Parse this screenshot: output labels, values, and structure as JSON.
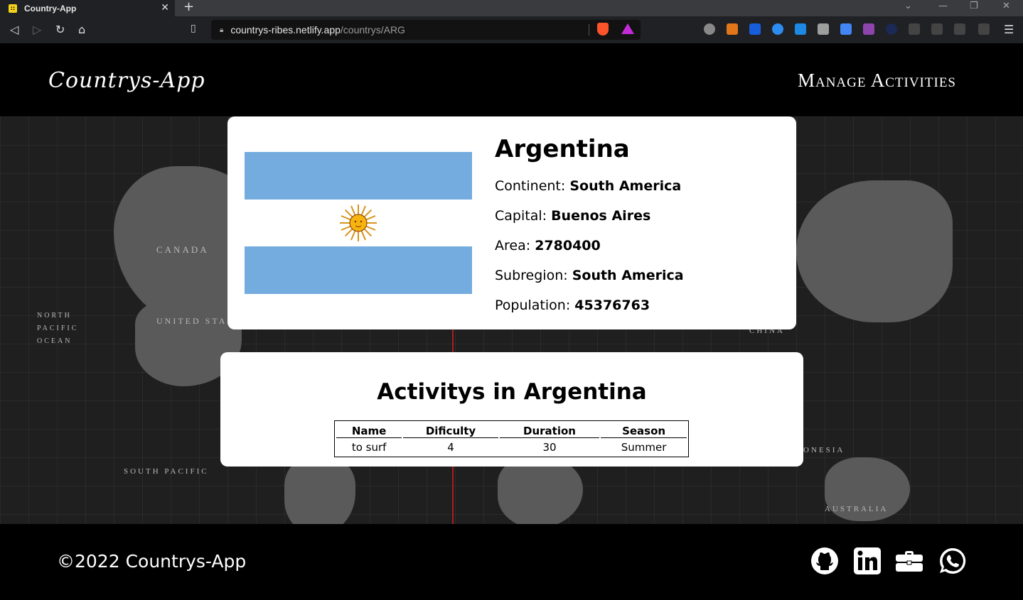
{
  "browser": {
    "tab_title": "Country-App",
    "tab_favicon": "::",
    "new_tab_label": "+",
    "close_label": "✕",
    "url_host": "countrys-ribes.netlify.app",
    "url_path": "/countrys/ARG"
  },
  "header": {
    "brand": "Countrys-App",
    "manage_link": "Manage Activities"
  },
  "country": {
    "name": "Argentina",
    "fields": [
      {
        "label": "Continent:",
        "value": "South America"
      },
      {
        "label": "Capital:",
        "value": "Buenos Aires"
      },
      {
        "label": "Area:",
        "value": "2780400"
      },
      {
        "label": "Subregion:",
        "value": "South America"
      },
      {
        "label": "Population:",
        "value": "45376763"
      }
    ],
    "flag_colors": {
      "stripe": "#74acdf",
      "sun": "#f6b40e"
    }
  },
  "activities": {
    "title": "Activitys in Argentina",
    "columns": [
      "Name",
      "Dificulty",
      "Duration",
      "Season"
    ],
    "rows": [
      [
        "to surf",
        "4",
        "30",
        "Summer"
      ]
    ]
  },
  "map_labels": {
    "canada": "CANADA",
    "united_states": "UNITED STA",
    "north_pacific": "NORTH PACIFIC OCEAN",
    "south_pacific": "SOUTH PACIFIC",
    "australia": "AUSTRALIA",
    "china": "CHINA",
    "indonesia": "ONESIA"
  },
  "footer": {
    "copyright": "©2022 Countrys-App",
    "social_icons": [
      "github-icon",
      "linkedin-icon",
      "briefcase-icon",
      "whatsapp-icon"
    ]
  }
}
